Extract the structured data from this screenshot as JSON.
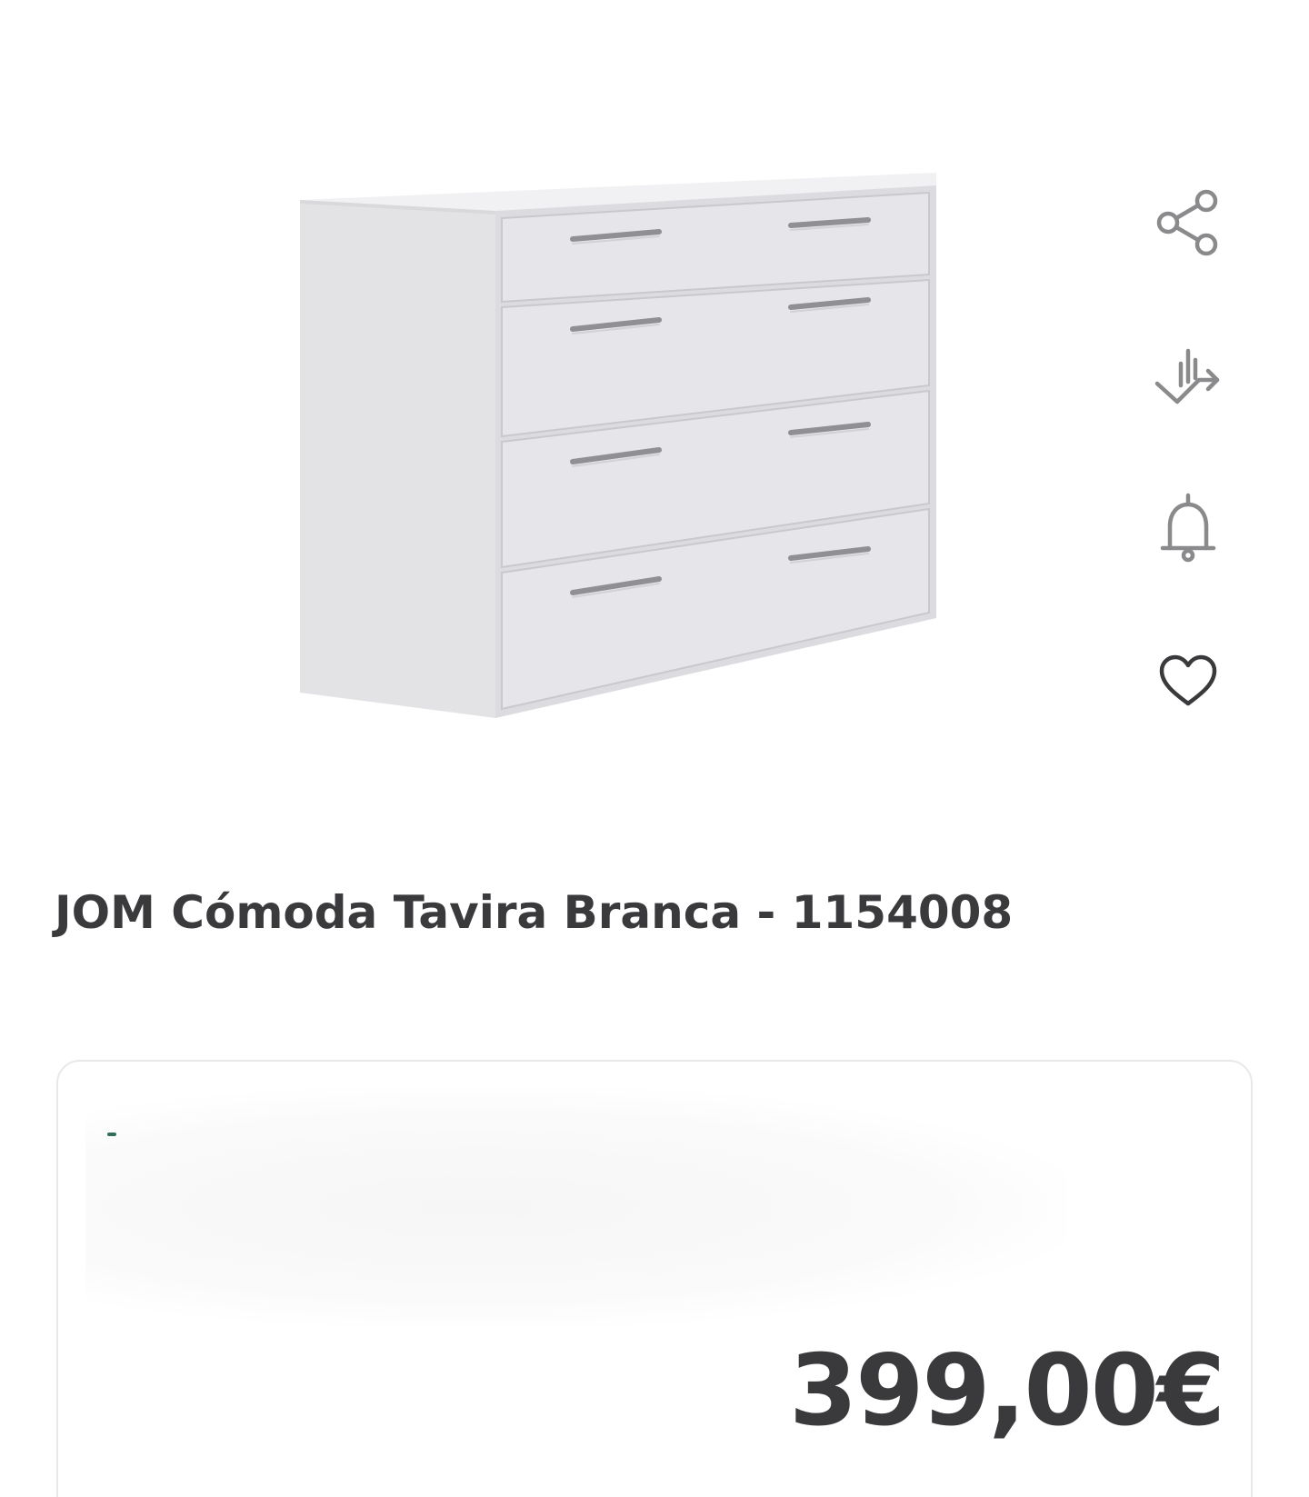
{
  "product": {
    "title": "JOM Cómoda Tavira Branca - 1154008",
    "image_icon": "dresser-image"
  },
  "actions": [
    {
      "icon": "share-icon"
    },
    {
      "icon": "price-history-icon"
    },
    {
      "icon": "bell-icon"
    },
    {
      "icon": "heart-icon"
    }
  ],
  "price_card": {
    "price": "399,00€"
  },
  "colors": {
    "text": "#3a3a3c",
    "icon": "#8a8a8c",
    "card_border": "#e8e8e8"
  }
}
